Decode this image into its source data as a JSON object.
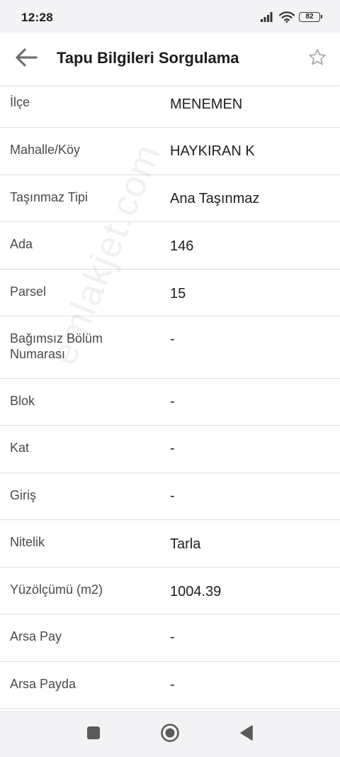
{
  "status_bar": {
    "time": "12:28",
    "battery": "82",
    "icons": [
      "signal-icon",
      "wifi-icon",
      "battery-icon"
    ]
  },
  "app_bar": {
    "title": "Tapu Bilgileri Sorgulama",
    "back_icon": "arrow-left-icon",
    "favorite_icon": "star-outline-icon"
  },
  "rows": [
    {
      "label": "İlçe",
      "value": "MENEMEN"
    },
    {
      "label": "Mahalle/Köy",
      "value": "HAYKIRAN K"
    },
    {
      "label": "Taşınmaz Tipi",
      "value": "Ana Taşınmaz"
    },
    {
      "label": "Ada",
      "value": "146"
    },
    {
      "label": "Parsel",
      "value": "15"
    },
    {
      "label": "Bağımsız Bölüm Numarası",
      "value": "-"
    },
    {
      "label": "Blok",
      "value": "-"
    },
    {
      "label": "Kat",
      "value": "-"
    },
    {
      "label": "Giriş",
      "value": "-"
    },
    {
      "label": "Nitelik",
      "value": "Tarla"
    },
    {
      "label": "Yüzölçümü (m2)",
      "value": "1004.39"
    },
    {
      "label": "Arsa Pay",
      "value": "-"
    },
    {
      "label": "Arsa Payda",
      "value": "-"
    }
  ],
  "watermark": "emlakjet.com",
  "nav_bar": {
    "icons": [
      "recents-square-icon",
      "home-circle-icon",
      "back-triangle-icon"
    ]
  },
  "colors": {
    "accent": "#9aa0a6",
    "divider": "#dedede",
    "bar_bg": "#f3f3f5"
  }
}
